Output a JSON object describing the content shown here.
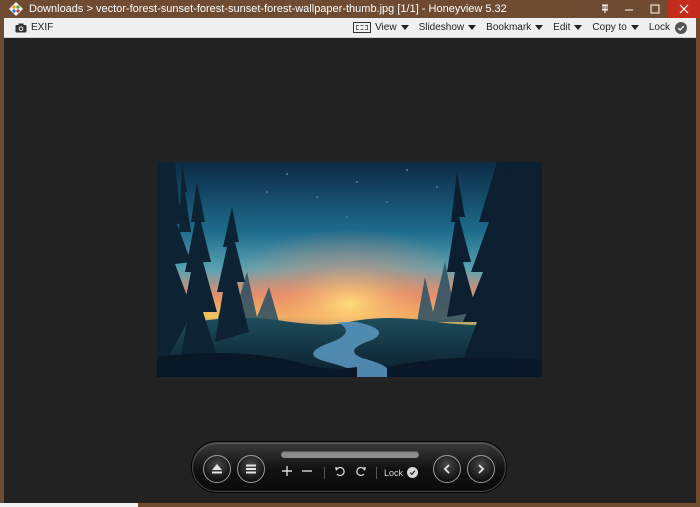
{
  "titlebar": {
    "title": "Downloads > vector-forest-sunset-forest-sunset-forest-wallpaper-thumb.jpg [1/1] - Honeyview 5.32",
    "pin_icon": "pin-icon",
    "minimize_icon": "minimize-icon",
    "maximize_icon": "maximize-icon",
    "close_icon": "close-icon"
  },
  "toolbar": {
    "exif_label": "EXIF",
    "view_label": "View",
    "slideshow_label": "Slideshow",
    "bookmark_label": "Bookmark",
    "edit_label": "Edit",
    "copyto_label": "Copy to",
    "lock_label": "Lock"
  },
  "viewer": {
    "background": "#222222"
  },
  "controlbar": {
    "lock_label": "Lock",
    "buttons": [
      "eject-icon",
      "menu-icon",
      "zoom-in-icon",
      "zoom-out-icon",
      "rotate-left-icon",
      "rotate-right-icon",
      "previous-icon",
      "next-icon"
    ]
  },
  "colors": {
    "frame": "#6f4b32",
    "close": "#c42b1c",
    "toolbar": "#f0f0f0"
  }
}
